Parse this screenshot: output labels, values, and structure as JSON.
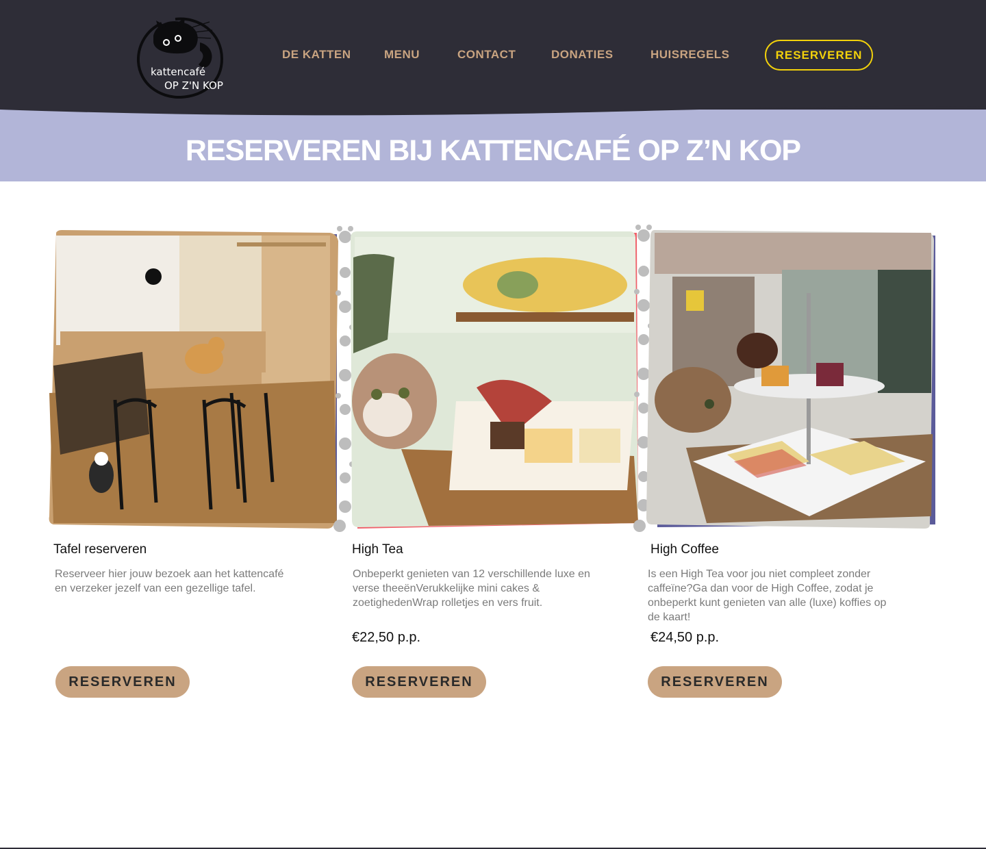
{
  "brand": {
    "logo_line1": "kattencafé",
    "logo_line2": "OP Z'N KOP"
  },
  "nav": {
    "items": [
      "DE KATTEN",
      "MENU",
      "CONTACT",
      "DONATIES",
      "HUISREGELS"
    ],
    "cta": "RESERVEREN"
  },
  "colors": {
    "header_bg": "#2e2d37",
    "title_band": "#b2b5d8",
    "nav_text": "#c9a481",
    "cta_accent": "#f2d10b",
    "button_bg": "#c9a481",
    "frame_purple": "#5b5b9a",
    "frame_red": "#f0606a"
  },
  "page": {
    "title": "RESERVEREN BIJ KATTENCAFÉ OP Z’N KOP"
  },
  "cards": [
    {
      "title": "Tafel reserveren",
      "description": "Reserveer hier jouw bezoek aan het kattencafé en verzeker jezelf van een gezellige tafel.",
      "price": "",
      "button": "RESERVEREN",
      "photo": "cat-cafe-interior-photo"
    },
    {
      "title": "High Tea",
      "description": "Onbeperkt genieten van 12 verschillende luxe en verse theeënVerukkelijke mini cakes & zoetighedenWrap rolletjes en vers fruit.",
      "price": "€22,50 p.p.",
      "button": "RESERVEREN",
      "photo": "high-tea-cat-photo"
    },
    {
      "title": "High Coffee",
      "description": "Is een High Tea voor jou niet compleet zonder caffeïne?Ga dan voor de High Coffee, zodat je onbeperkt kunt genieten van alle (luxe) koffies op de kaart!",
      "price": "€24,50 p.p.",
      "button": "RESERVEREN",
      "photo": "high-coffee-cat-photo"
    }
  ]
}
